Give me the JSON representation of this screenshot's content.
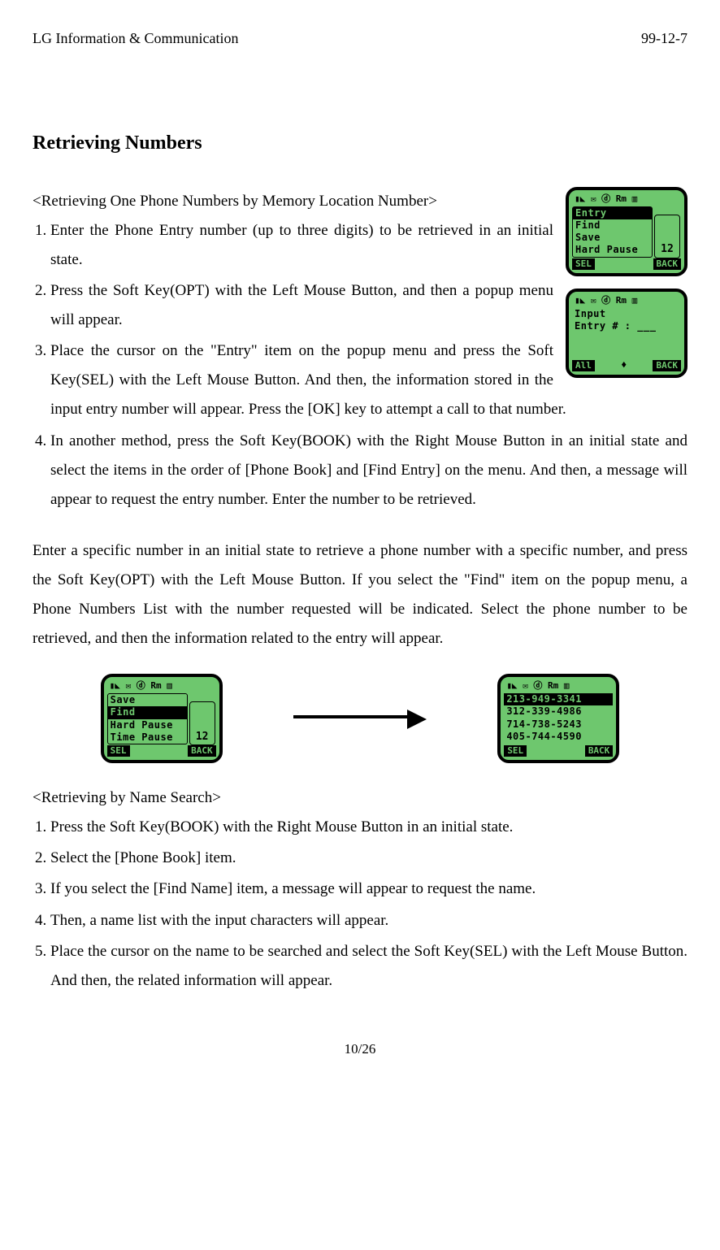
{
  "header": {
    "left": "LG Information & Communication",
    "right": "99-12-7"
  },
  "title": "Retrieving Numbers",
  "section1": {
    "title": "<Retrieving One Phone Numbers by Memory Location Number>",
    "items": [
      "Enter the Phone Entry number (up to three digits) to be retrieved in an initial state.",
      "Press the Soft Key(OPT) with the Left Mouse Button, and then a popup menu will appear.",
      "Place the cursor on the \"Entry\" item on the popup menu and press the Soft Key(SEL) with the Left Mouse Button. And then, the information stored in the input entry number will appear. Press the [OK] key to attempt a call to that number.",
      "In another method, press the Soft Key(BOOK) with the Right Mouse Button in an initial state and select the items in the order of [Phone Book] and [Find Entry] on the menu. And then, a message will appear to request the entry number. Enter the number to be retrieved."
    ]
  },
  "para1": "Enter a specific number in an initial state to retrieve a phone number with a specific number, and press the Soft Key(OPT) with the Left Mouse Button. If you select the \"Find\" item on the popup menu, a Phone Numbers List with the number requested will be indicated. Select the phone number to be retrieved, and then the information related to the entry will appear.",
  "section2": {
    "title": "<Retrieving by Name Search>",
    "items": [
      "Press the Soft Key(BOOK) with the Right Mouse Button in an initial state.",
      "Select the [Phone Book] item.",
      "If you select the [Find Name] item, a message will appear to request the name.",
      "Then, a name list with the input characters will appear.",
      "Place the cursor on the name to be searched and select the Soft Key(SEL) with the Left Mouse Button.                And then, the related information will appear."
    ]
  },
  "footer": "10/26",
  "screens": {
    "s1": {
      "menu": [
        "Entry",
        "Find",
        "Save",
        "Hard Pause"
      ],
      "hl": 0,
      "side": "12",
      "sk_left": "SEL",
      "sk_right": "BACK",
      "status": "▮◣   ✉ ⓓ Rm ▥"
    },
    "s2": {
      "lines": [
        "Input",
        "Entry # : ___"
      ],
      "sk_left": "All",
      "sk_right": "BACK",
      "status": "▮◣   ✉ ⓓ Rm ▥",
      "mid": "♦"
    },
    "s3": {
      "menu": [
        "Save",
        "Find",
        "Hard Pause",
        "Time Pause"
      ],
      "hl": 1,
      "side": "12",
      "sk_left": "SEL",
      "sk_right": "BACK",
      "status": "▮◣   ✉ ⓓ Rm ▥"
    },
    "s4": {
      "lines": [
        "213-949-3341",
        "312-339-4986",
        "714-738-5243",
        "405-744-4590"
      ],
      "hl": 0,
      "sk_left": "SEL",
      "sk_right": "BACK",
      "status": "▮◣   ✉ ⓓ Rm ▥"
    }
  }
}
